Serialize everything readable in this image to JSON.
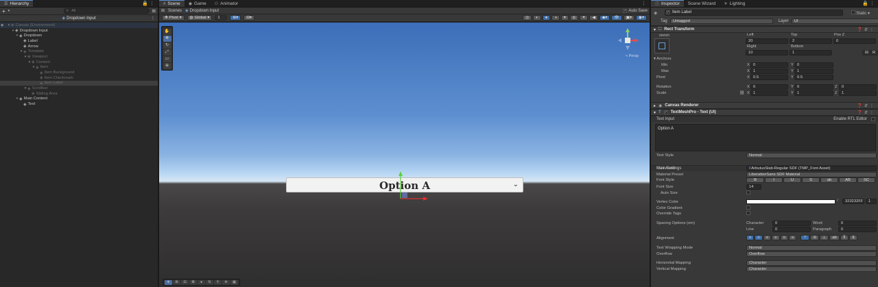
{
  "hierarchy": {
    "tab_label": "Hierarchy",
    "add_label": "+",
    "search_placeholder": "All",
    "scene_name": "Dropdown Input",
    "rows": [
      {
        "label": "Canvas (Environment)",
        "indent": 1,
        "dim": true,
        "env": true
      },
      {
        "label": "Dropdown Input",
        "indent": 2
      },
      {
        "label": "Dropdown",
        "indent": 3
      },
      {
        "label": "Label",
        "indent": 4
      },
      {
        "label": "Arrow",
        "indent": 4
      },
      {
        "label": "Template",
        "indent": 4,
        "dim": true
      },
      {
        "label": "Viewport",
        "indent": 5,
        "dim": true
      },
      {
        "label": "Content",
        "indent": 6,
        "dim": true
      },
      {
        "label": "Item",
        "indent": 7,
        "dim": true
      },
      {
        "label": "Item Background",
        "indent": 8,
        "dim": true
      },
      {
        "label": "Item Checkmark",
        "indent": 8,
        "dim": true
      },
      {
        "label": "Item Label",
        "indent": 8,
        "dim": true,
        "selected": true
      },
      {
        "label": "Scrollbar",
        "indent": 5,
        "dim": true
      },
      {
        "label": "Sliding Area",
        "indent": 6,
        "dim": true
      },
      {
        "label": "Main Content",
        "indent": 3
      },
      {
        "label": "Text",
        "indent": 4
      }
    ]
  },
  "scene": {
    "tabs": [
      "Scene",
      "Game",
      "Animator"
    ],
    "scenes_label": "Scenes",
    "breadcrumb": "Dropdown Input",
    "auto_save_label": "Auto Save",
    "pivot_label": "Pivot",
    "global_label": "Global",
    "snap_value": "1",
    "persp_label": "< Persp",
    "dropdown_text": "Option A",
    "dropdown_arrow": "⌄"
  },
  "inspector": {
    "tabs": [
      "Inspector",
      "Scene Wizard",
      "Lighting"
    ],
    "object_name": "Item Label",
    "static_label": "Static",
    "tag_label": "Tag",
    "tag_value": "Untagged",
    "layer_label": "Layer",
    "layer_value": "UI",
    "rect_transform": {
      "title": "Rect Transform",
      "stretch_label": "stretch",
      "left_label": "Left",
      "left": "20",
      "top_label": "Top",
      "top": "2",
      "posz_label": "Pos Z",
      "posz": "0",
      "right_label": "Right",
      "right": "10",
      "bottom_label": "Bottom",
      "bottom": "1",
      "r_btn": "R",
      "anchors_label": "Anchors",
      "min_label": "Min",
      "min_x": "0",
      "min_y": "0",
      "max_label": "Max",
      "max_x": "1",
      "max_y": "1",
      "pivot_label": "Pivot",
      "pivot_x": "0.5",
      "pivot_y": "0.5",
      "rotation_label": "Rotation",
      "rot_x": "0",
      "rot_y": "0",
      "rot_z": "0",
      "scale_label": "Scale",
      "scale_x": "1",
      "scale_y": "1",
      "scale_z": "1",
      "x": "X",
      "y": "Y",
      "z": "Z"
    },
    "canvas_renderer_title": "Canvas Renderer",
    "tmp": {
      "title": "TextMeshPro - Text (UI)",
      "text_input_label": "Text Input",
      "enable_rtl_label": "Enable RTL Editor",
      "text_value": "Option A",
      "text_style_label": "Text Style",
      "text_style_value": "Normal",
      "main_settings_label": "Main Settings",
      "font_asset_label": "Font Asset",
      "font_asset_value": "ArbutusSlab-Regular SDF (TMP_Font Asset)",
      "material_preset_label": "Material Preset",
      "material_preset_value": "LiberationSans SDF Material",
      "font_style_label": "Font Style",
      "font_style_buttons": [
        "B",
        "I",
        "U",
        "S",
        "ab",
        "AB",
        "SC"
      ],
      "font_size_label": "Font Size",
      "font_size_value": "14",
      "auto_size_label": "Auto Size",
      "vertex_color_label": "Vertex Color",
      "vertex_color_hex": "323232FF",
      "vertex_color_alpha": "1",
      "color_gradient_label": "Color Gradient",
      "override_tags_label": "Override Tags",
      "spacing_label": "Spacing Options (em)",
      "character_label": "Character",
      "character_value": "0",
      "word_label": "Word",
      "word_value": "0",
      "line_label": "Line",
      "line_value": "0",
      "paragraph_label": "Paragraph",
      "paragraph_value": "0",
      "alignment_label": "Alignment",
      "wrapping_label": "Text Wrapping Mode",
      "wrapping_value": "Normal",
      "overflow_label": "Overflow",
      "overflow_value": "Overflow",
      "h_mapping_label": "Horizontal Mapping",
      "h_mapping_value": "Character",
      "v_mapping_label": "Vertical Mapping",
      "v_mapping_value": "Character"
    }
  },
  "colors": {
    "accent": "#3d6ea8",
    "vertex_color": "#ffffff"
  }
}
